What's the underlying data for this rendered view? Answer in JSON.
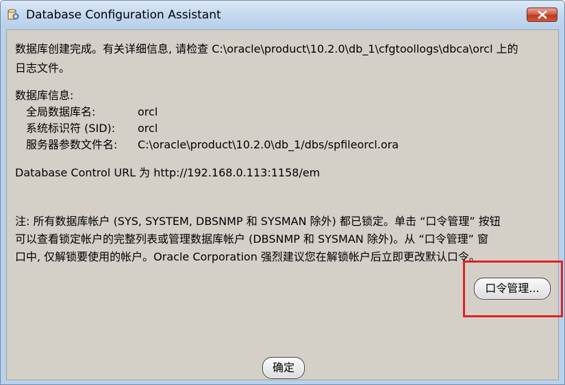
{
  "window": {
    "title": "Database Configuration Assistant",
    "close_icon": "close-x-icon",
    "app_icon": "dbca-app-icon"
  },
  "message": {
    "line1": "数据库创建完成。有关详细信息, 请检查 C:\\oracle\\product\\10.2.0\\db_1\\cfgtoollogs\\dbca\\orcl 上的",
    "line2": "日志文件。"
  },
  "db_info": {
    "heading": "数据库信息:",
    "rows": [
      {
        "label": "全局数据库名:",
        "value": "orcl"
      },
      {
        "label": "系统标识符 (SID):",
        "value": "orcl"
      },
      {
        "label": "服务器参数文件名:",
        "value": "C:\\oracle\\product\\10.2.0\\db_1/dbs/spfileorcl.ora"
      }
    ]
  },
  "control_url": "Database Control URL 为 http://192.168.0.113:1158/em",
  "note": {
    "line1": "注: 所有数据库帐户 (SYS, SYSTEM, DBSNMP 和 SYSMAN 除外) 都已锁定。单击 “口令管理” 按钮",
    "line2": "可以查看锁定帐户的完整列表或管理数据库帐户 (DBSNMP 和 SYSMAN 除外)。从 “口令管理” 窗",
    "line3": "口中, 仅解锁要使用的帐户。Oracle Corporation 强烈建议您在解锁帐户后立即更改默认口令。"
  },
  "buttons": {
    "password_management": "口令管理...",
    "ok": "确定"
  },
  "colors": {
    "dialog_background": "#d4d0c8",
    "highlight": "#e02020",
    "close_button": "#c0381f"
  }
}
